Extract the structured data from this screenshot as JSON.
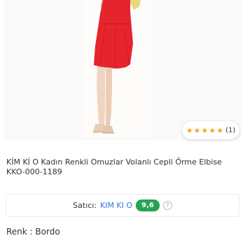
{
  "product": {
    "rating": {
      "stars": 5,
      "count": "(1)"
    },
    "title_line1": "KİM Kİ O Kadın Renkli Omuzlar Volanlı Cepli Örme Elbise",
    "title_line2": "KKO-000-1189",
    "dress_color": "#e5242e"
  },
  "seller": {
    "label": "Satıcı:",
    "name": "KIM KI O",
    "score": "9,6",
    "score_color": "#27a34d",
    "info_icon": "question-mark"
  },
  "color": {
    "text": "Renk : Bordo"
  }
}
